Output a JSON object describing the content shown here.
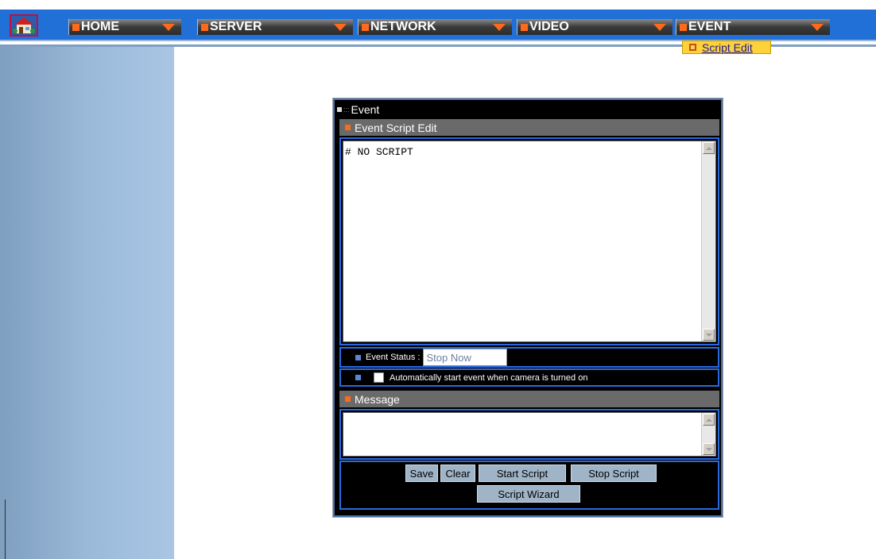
{
  "nav": {
    "home": "HOME",
    "server": "SERVER",
    "network": "NETWORK",
    "video": "VIDEO",
    "event": "EVENT",
    "submenu_item": "Script Edit"
  },
  "panel": {
    "title": "Event",
    "script_section": "Event Script Edit",
    "script_text": "# NO SCRIPT",
    "status_label": "Event Status :",
    "status_value": "Stop Now",
    "auto_start_label": "Automatically start event when camera is turned on",
    "message_section": "Message",
    "message_text": ""
  },
  "buttons": {
    "save": "Save",
    "clear": "Clear",
    "start_script": "Start Script",
    "stop_script": "Stop Script",
    "script_wizard": "Script Wizard"
  },
  "colors": {
    "accent_orange": "#ff6a1a",
    "nav_blue": "#2070d8",
    "frame_blue": "#2a6ae0"
  }
}
